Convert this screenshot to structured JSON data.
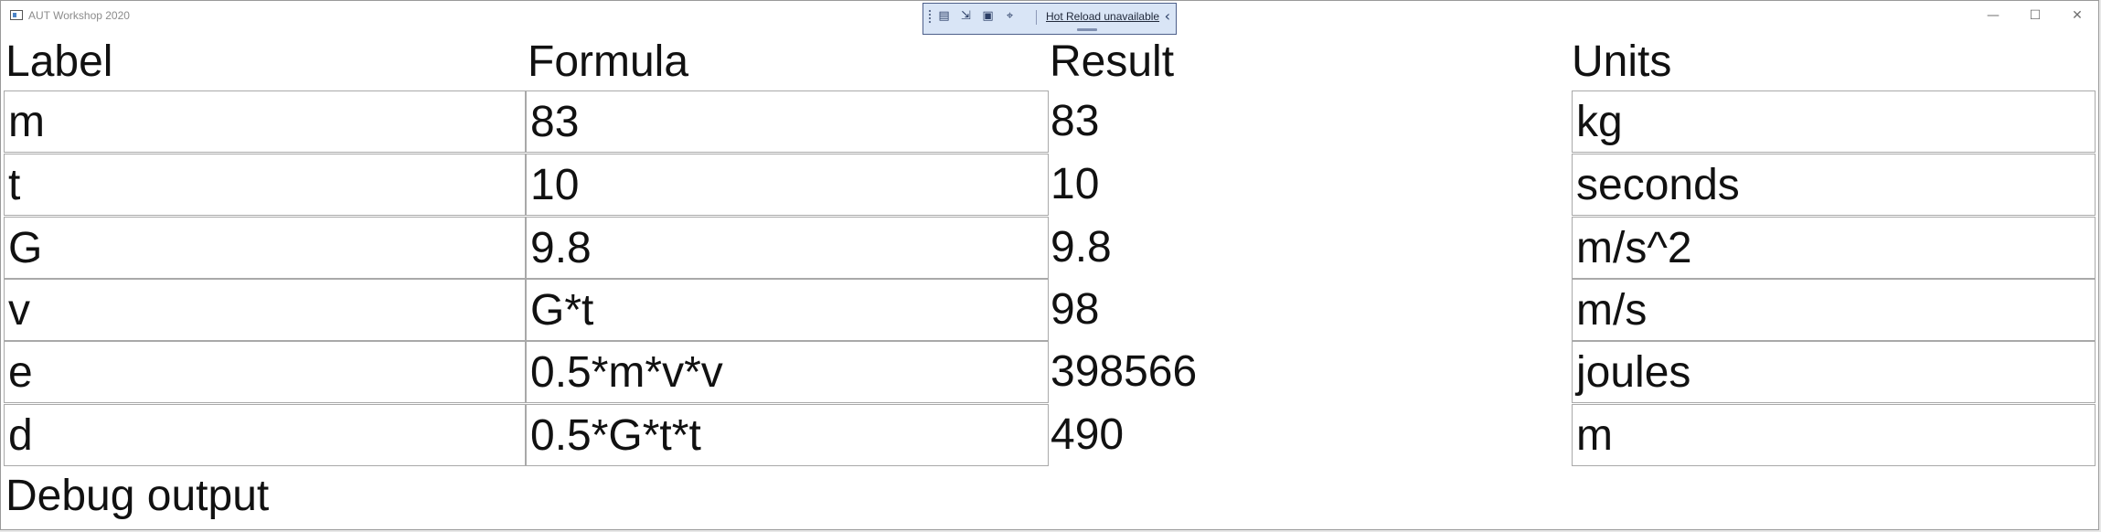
{
  "window": {
    "title": "AUT Workshop 2020",
    "controls": {
      "minimize_icon": "minimize-icon",
      "maximize_icon": "maximize-icon",
      "close_icon": "close-icon"
    }
  },
  "hot_reload_toolbar": {
    "label": "Hot Reload unavailable",
    "icons": [
      "select-element-icon",
      "display-layout-adorners-icon",
      "track-focused-element-icon",
      "live-visual-tree-icon",
      "collapse-icon"
    ]
  },
  "grid": {
    "headers": [
      "Label",
      "Formula",
      "Result",
      "Units"
    ],
    "rows": [
      {
        "label": "m",
        "formula": "83",
        "result": "83",
        "units": "kg"
      },
      {
        "label": "t",
        "formula": "10",
        "result": "10",
        "units": "seconds"
      },
      {
        "label": "G",
        "formula": "9.8",
        "result": "9.8",
        "units": "m/s^2"
      },
      {
        "label": "v",
        "formula": "G*t",
        "result": "98",
        "units": "m/s"
      },
      {
        "label": "e",
        "formula": "0.5*m*v*v",
        "result": "398566",
        "units": "joules"
      },
      {
        "label": "d",
        "formula": "0.5*G*t*t",
        "result": "490",
        "units": "m"
      }
    ]
  },
  "debug": {
    "label": "Debug output"
  },
  "colors": {
    "window_bg": "#ffffff",
    "input_border": "#a9a9a9",
    "toolbar_bg": "#d9e5f6",
    "toolbar_border": "#4d5f8a"
  }
}
